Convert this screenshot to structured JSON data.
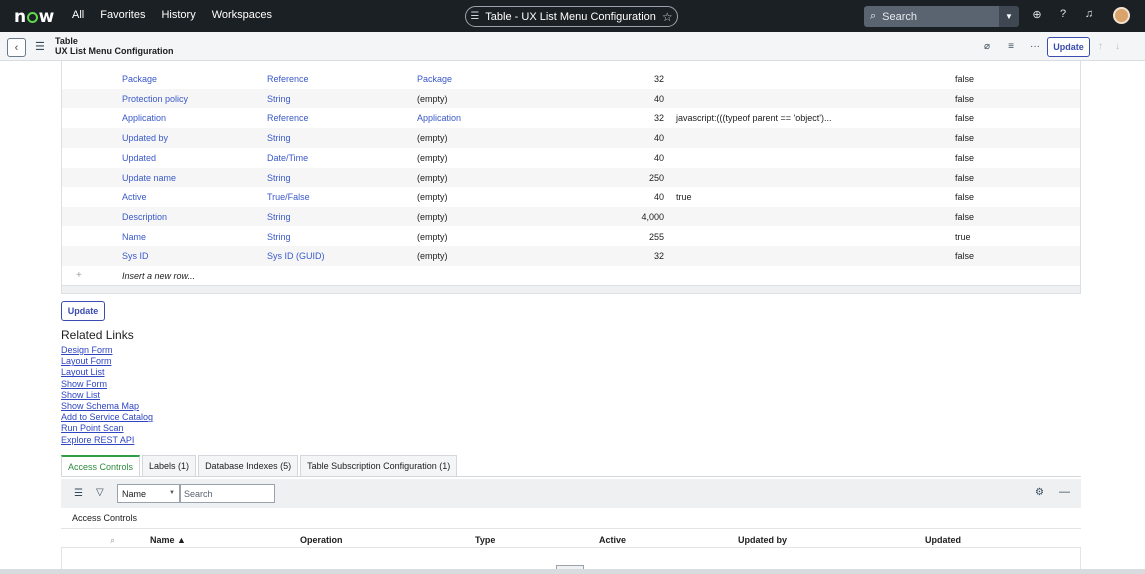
{
  "nav": {
    "logo": "now",
    "links": [
      "All",
      "Favorites",
      "History",
      "Workspaces"
    ],
    "context_title": "Table - UX List Menu Configuration",
    "search_placeholder": "Search"
  },
  "header": {
    "type_label": "Table",
    "record_title": "UX List Menu Configuration",
    "update_label": "Update"
  },
  "columns_table": {
    "rows": [
      {
        "label": "Package",
        "type": "Reference",
        "reference": "Package",
        "max_length": "32",
        "default": "",
        "display": "false"
      },
      {
        "label": "Protection policy",
        "type": "String",
        "reference": "(empty)",
        "max_length": "40",
        "default": "",
        "display": "false"
      },
      {
        "label": "Application",
        "type": "Reference",
        "reference": "Application",
        "max_length": "32",
        "default": "javascript:(((typeof parent == 'object')...",
        "display": "false"
      },
      {
        "label": "Updated by",
        "type": "String",
        "reference": "(empty)",
        "max_length": "40",
        "default": "",
        "display": "false"
      },
      {
        "label": "Updated",
        "type": "Date/Time",
        "reference": "(empty)",
        "max_length": "40",
        "default": "",
        "display": "false"
      },
      {
        "label": "Update name",
        "type": "String",
        "reference": "(empty)",
        "max_length": "250",
        "default": "",
        "display": "false"
      },
      {
        "label": "Active",
        "type": "True/False",
        "reference": "(empty)",
        "max_length": "40",
        "default": "true",
        "display": "false"
      },
      {
        "label": "Description",
        "type": "String",
        "reference": "(empty)",
        "max_length": "4,000",
        "default": "",
        "display": "false"
      },
      {
        "label": "Name",
        "type": "String",
        "reference": "(empty)",
        "max_length": "255",
        "default": "",
        "display": "true"
      },
      {
        "label": "Sys ID",
        "type": "Sys ID (GUID)",
        "reference": "(empty)",
        "max_length": "32",
        "default": "",
        "display": "false"
      }
    ],
    "insert_label": "Insert a new row..."
  },
  "update_button": "Update",
  "related_links": {
    "title": "Related Links",
    "items": [
      "Design Form",
      "Layout Form",
      "Layout List",
      "Show Form",
      "Show List",
      "Show Schema Map",
      "Add to Service Catalog",
      "Run Point Scan",
      "Explore REST API"
    ]
  },
  "tabs": [
    "Access Controls",
    "Labels (1)",
    "Database Indexes (5)",
    "Table Subscription Configuration (1)"
  ],
  "acl": {
    "filter_field": "Name",
    "search_placeholder": "Search",
    "list_title": "Access Controls",
    "headers": [
      "Name ▲",
      "Operation",
      "Type",
      "Active",
      "Updated by",
      "Updated"
    ]
  }
}
